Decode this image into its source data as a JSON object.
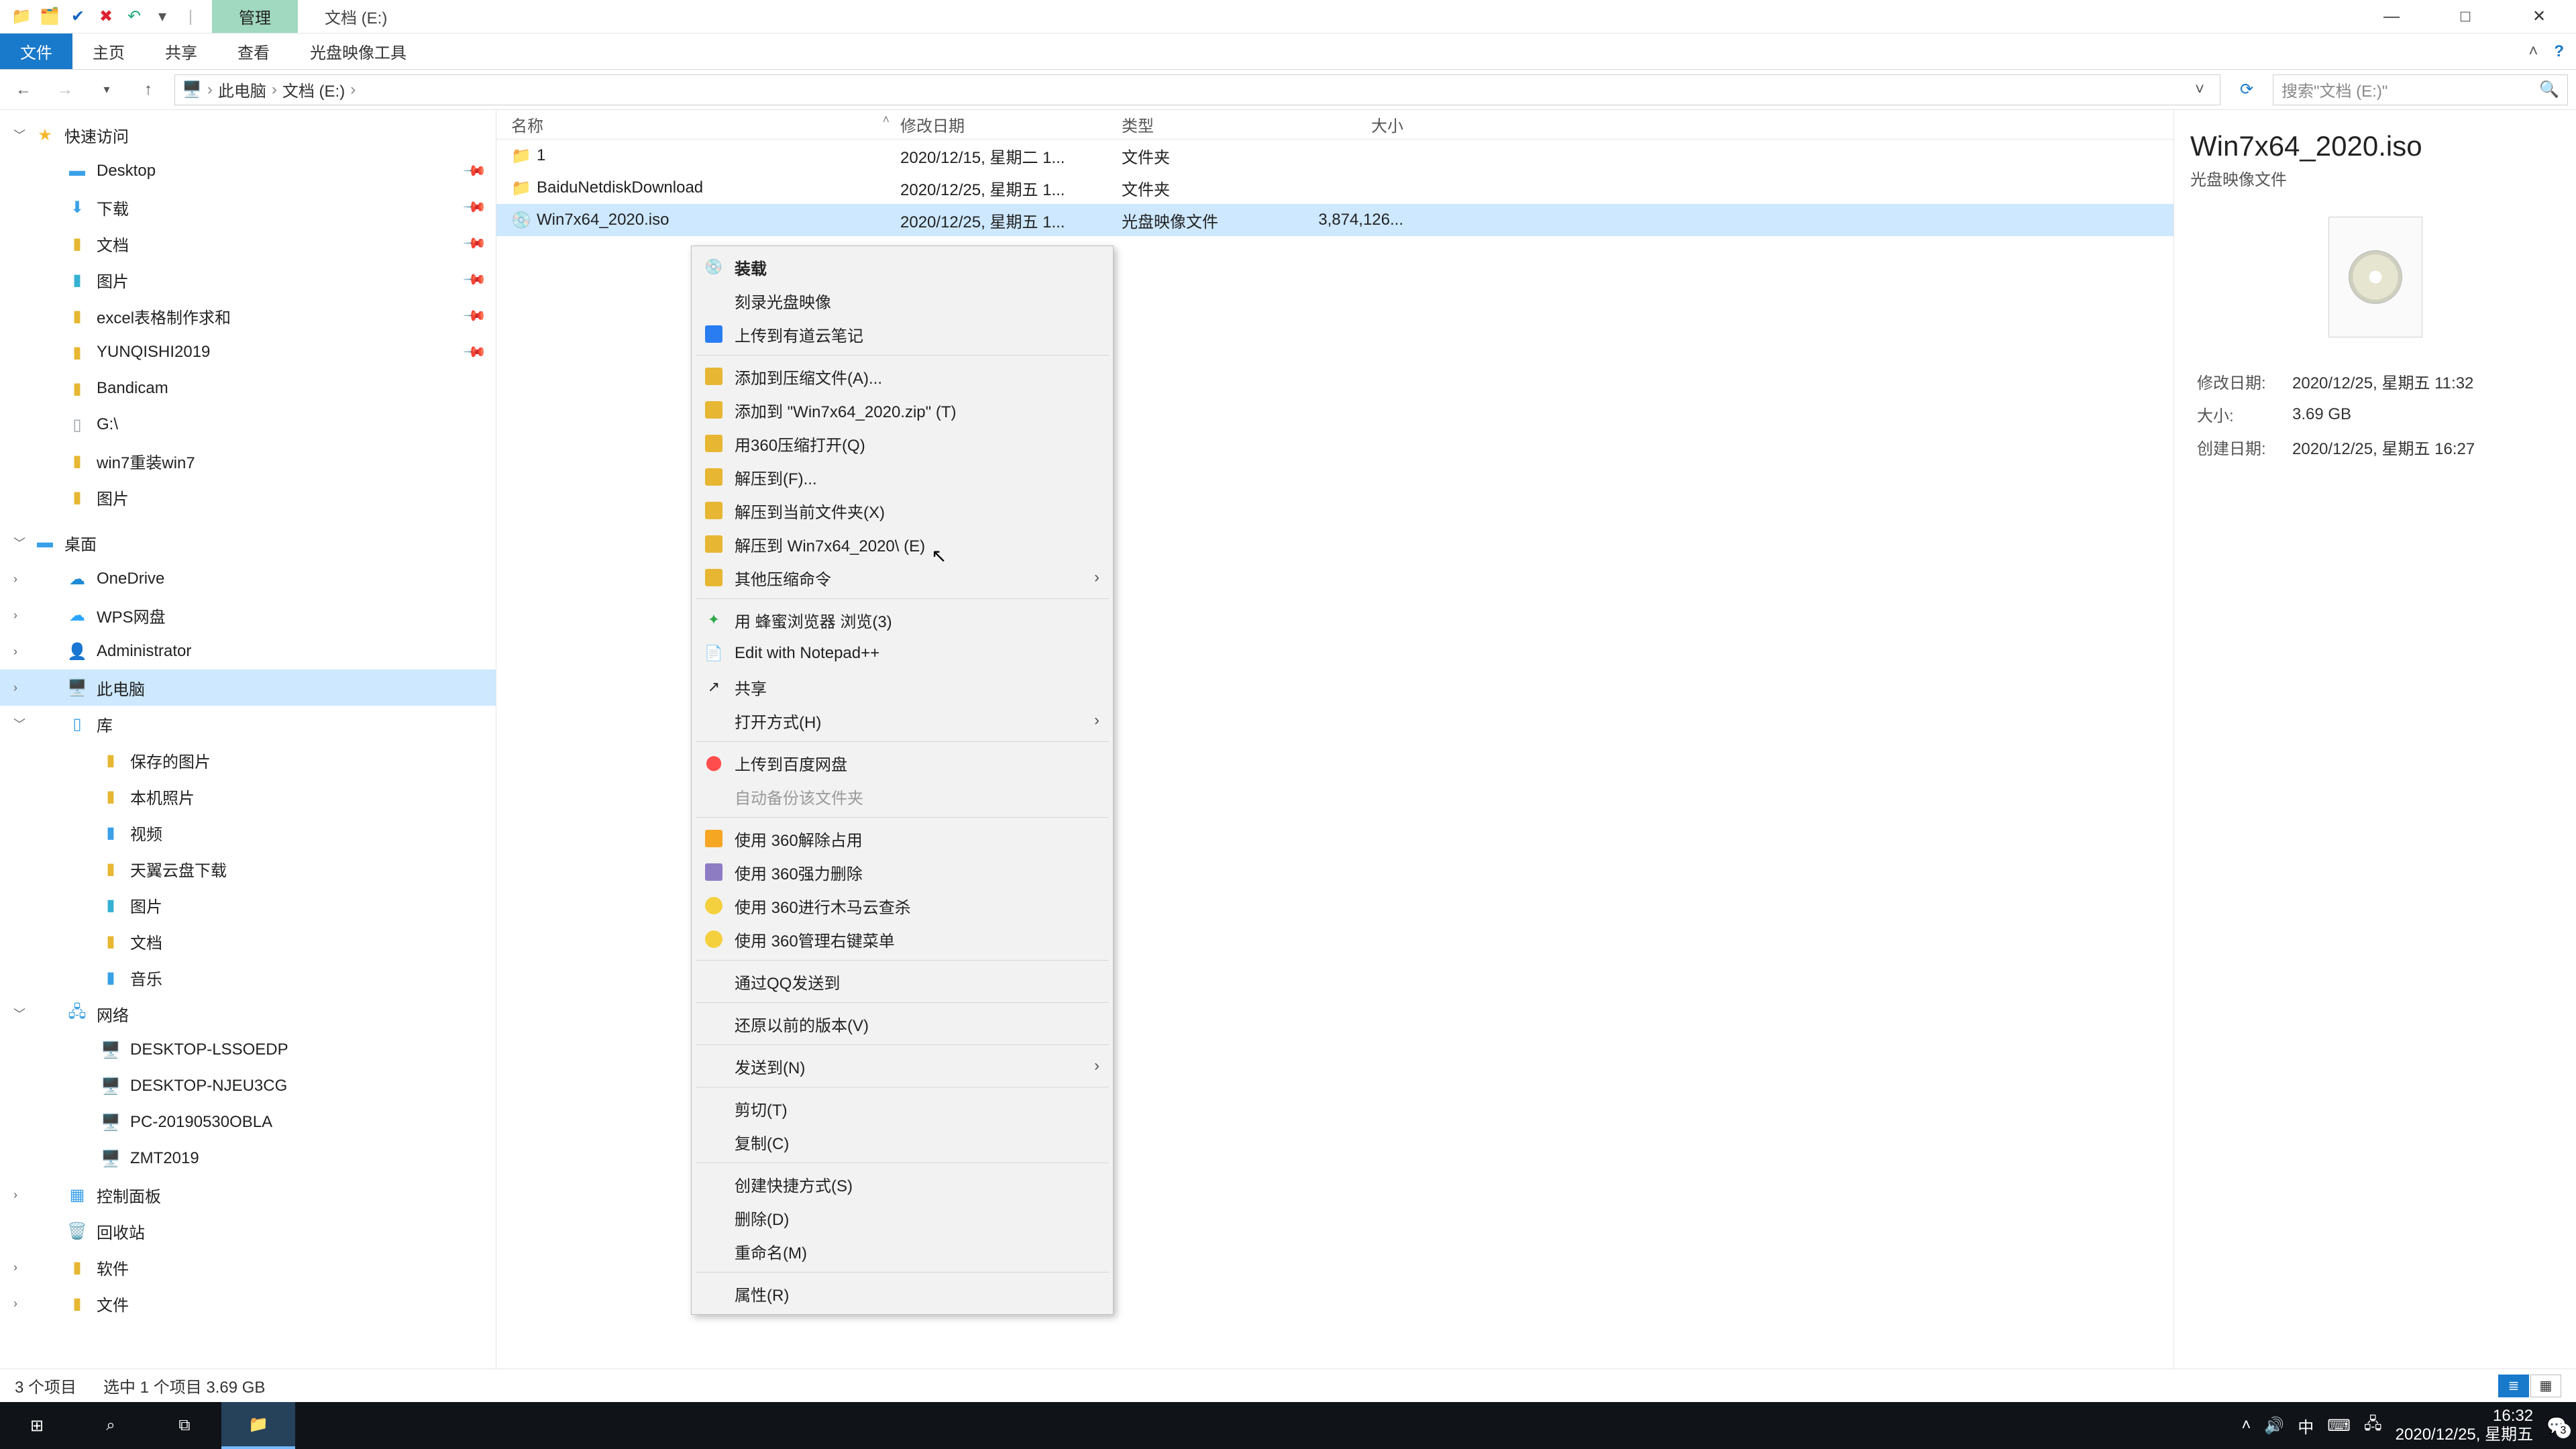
{
  "window": {
    "context_tab": "管理",
    "title": "文档 (E:)",
    "ribbon": {
      "file": "文件",
      "home": "主页",
      "share": "共享",
      "view": "查看",
      "tool": "光盘映像工具"
    }
  },
  "addr": {
    "root": "此电脑",
    "loc": "文档 (E:)",
    "search_placeholder": "搜索\"文档 (E:)\""
  },
  "nav": {
    "quick": "快速访问",
    "desktop": "Desktop",
    "downloads": "下载",
    "documents": "文档",
    "pictures": "图片",
    "excel": "excel表格制作求和",
    "yunqishi": "YUNQISHI2019",
    "bandicam": "Bandicam",
    "gdrive": "G:\\",
    "win7re": "win7重装win7",
    "pictures2": "图片",
    "desktop_root": "桌面",
    "onedrive": "OneDrive",
    "wps": "WPS网盘",
    "admin": "Administrator",
    "thispc": "此电脑",
    "libraries": "库",
    "saved_pics": "保存的图片",
    "local_photos": "本机照片",
    "videos": "视频",
    "tianyi": "天翼云盘下载",
    "pictures3": "图片",
    "docs2": "文档",
    "music": "音乐",
    "network": "网络",
    "pc1": "DESKTOP-LSSOEDP",
    "pc2": "DESKTOP-NJEU3CG",
    "pc3": "PC-20190530OBLA",
    "pc4": "ZMT2019",
    "controlpanel": "控制面板",
    "recycle": "回收站",
    "software": "软件",
    "files": "文件"
  },
  "cols": {
    "name": "名称",
    "date": "修改日期",
    "type": "类型",
    "size": "大小"
  },
  "rows": [
    {
      "name": "1",
      "date": "2020/12/15, 星期二 1...",
      "type": "文件夹",
      "size": ""
    },
    {
      "name": "BaiduNetdiskDownload",
      "date": "2020/12/25, 星期五 1...",
      "type": "文件夹",
      "size": ""
    },
    {
      "name": "Win7x64_2020.iso",
      "date": "2020/12/25, 星期五 1...",
      "type": "光盘映像文件",
      "size": "3,874,126..."
    }
  ],
  "ctx": {
    "mount": "装载",
    "burn": "刻录光盘映像",
    "youdao": "上传到有道云笔记",
    "addarchive": "添加到压缩文件(A)...",
    "addzip": "添加到 \"Win7x64_2020.zip\" (T)",
    "open360": "用360压缩打开(Q)",
    "extract_to": "解压到(F)...",
    "extract_here": "解压到当前文件夹(X)",
    "extract_named": "解压到 Win7x64_2020\\ (E)",
    "other_compress": "其他压缩命令",
    "honey": "用 蜂蜜浏览器 浏览(3)",
    "npp": "Edit with Notepad++",
    "share": "共享",
    "openwith": "打开方式(H)",
    "baidu": "上传到百度网盘",
    "autobackup": "自动备份该文件夹",
    "unlock360": "使用 360解除占用",
    "force360": "使用 360强力删除",
    "trojan360": "使用 360进行木马云查杀",
    "manage360": "使用 360管理右键菜单",
    "qq": "通过QQ发送到",
    "restore": "还原以前的版本(V)",
    "sendto": "发送到(N)",
    "cut": "剪切(T)",
    "copy": "复制(C)",
    "shortcut": "创建快捷方式(S)",
    "delete": "删除(D)",
    "rename": "重命名(M)",
    "props": "属性(R)"
  },
  "details": {
    "title": "Win7x64_2020.iso",
    "subtitle": "光盘映像文件",
    "mod_k": "修改日期:",
    "mod_v": "2020/12/25, 星期五 11:32",
    "size_k": "大小:",
    "size_v": "3.69 GB",
    "create_k": "创建日期:",
    "create_v": "2020/12/25, 星期五 16:27"
  },
  "status": {
    "count": "3 个项目",
    "selected": "选中 1 个项目  3.69 GB"
  },
  "tray": {
    "ime": "中",
    "time": "16:32",
    "date": "2020/12/25, 星期五",
    "notif": "3"
  }
}
